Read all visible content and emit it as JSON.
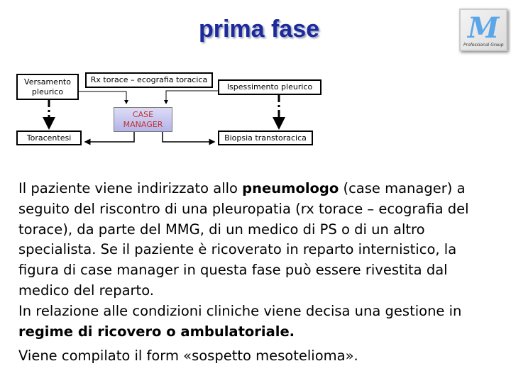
{
  "title": "prima fase",
  "logo": {
    "text": "M",
    "caption": "Professional Group"
  },
  "diagram": {
    "versamento": "Versamento pleurico",
    "rx": "Rx torace – ecografia toracica",
    "ispessimento": "Ispessimento pleurico",
    "case_manager": "CASE MANAGER",
    "toracentesi": "Toracentesi",
    "biopsia": "Biopsia transtoracica"
  },
  "body": {
    "p1a": "Il paziente viene indirizzato allo ",
    "p1b": "pneumologo",
    "p1c": " (case manager) a seguito del riscontro di una pleuropatia (rx torace – ecografia del torace), da parte del MMG, di un medico di PS o di un altro specialista. Se il paziente è ricoverato in reparto internistico, la figura di case manager in questa fase può essere rivestita dal medico del reparto.",
    "p2a": "In relazione alle condizioni cliniche viene decisa una gestione in ",
    "p2b": "regime di ricovero o ambulatoriale.",
    "p3": "Viene compilato il form «sospetto mesotelioma»."
  }
}
